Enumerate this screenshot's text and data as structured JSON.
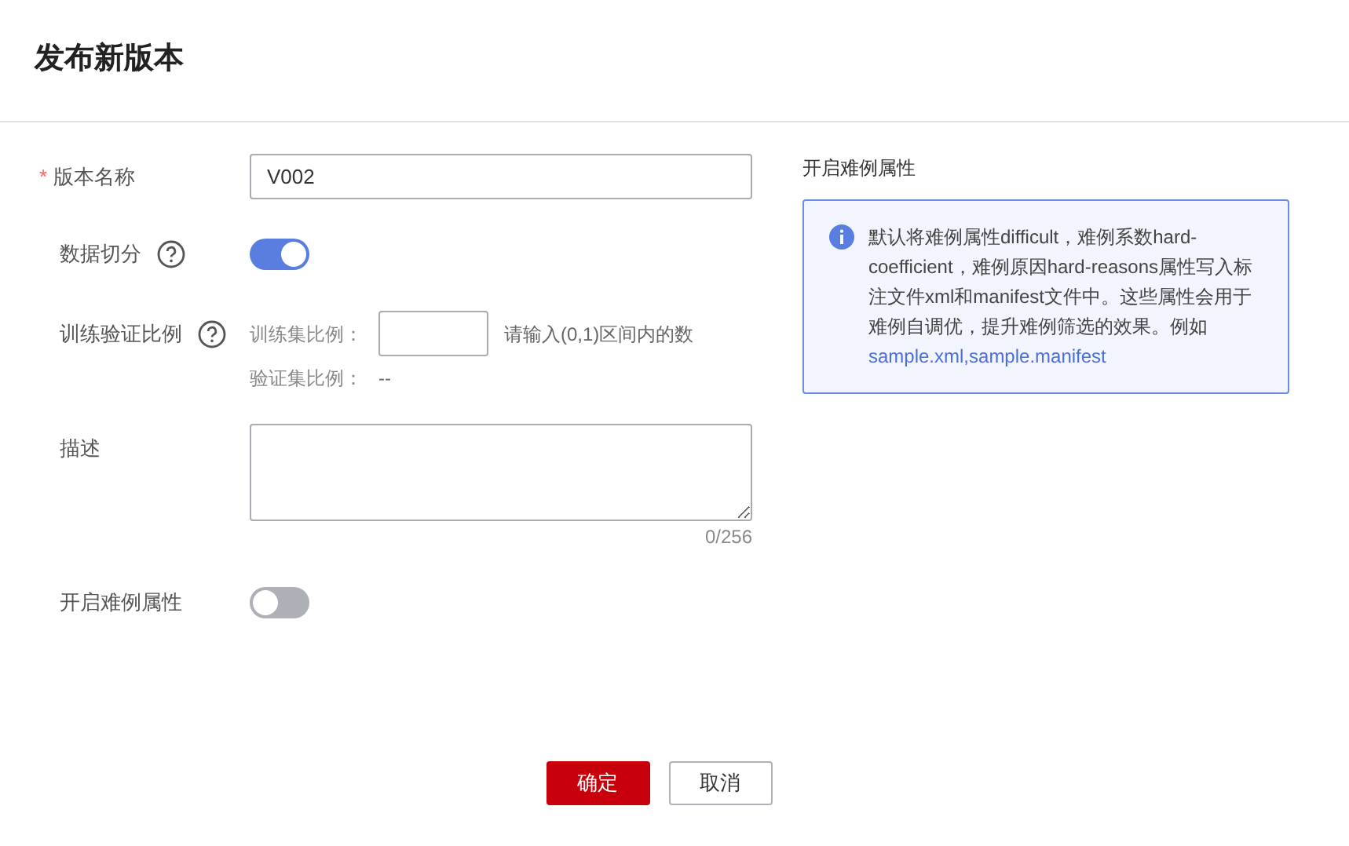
{
  "dialog": {
    "title": "发布新版本"
  },
  "form": {
    "version_name": {
      "label": "版本名称",
      "required_mark": "*",
      "value": "V002"
    },
    "data_split": {
      "label": "数据切分",
      "on": true
    },
    "ratio": {
      "label": "训练验证比例",
      "train_label": "训练集比例：",
      "hint": "请输入(0,1)区间内的数",
      "validation_label": "验证集比例：",
      "validation_value": "--"
    },
    "description": {
      "label": "描述",
      "counter": "0/256"
    },
    "hard_example": {
      "label": "开启难例属性",
      "on": false
    }
  },
  "info_panel": {
    "title": "开启难例属性",
    "text": "默认将难例属性difficult，难例系数hard-coefficient，难例原因hard-reasons属性写入标注文件xml和manifest文件中。这些属性会用于难例自调优，提升难例筛选的效果。例如",
    "link": "sample.xml,sample.manifest"
  },
  "buttons": [
    {
      "label": "确定",
      "kind": "primary"
    },
    {
      "label": "取消",
      "kind": "secondary"
    }
  ]
}
